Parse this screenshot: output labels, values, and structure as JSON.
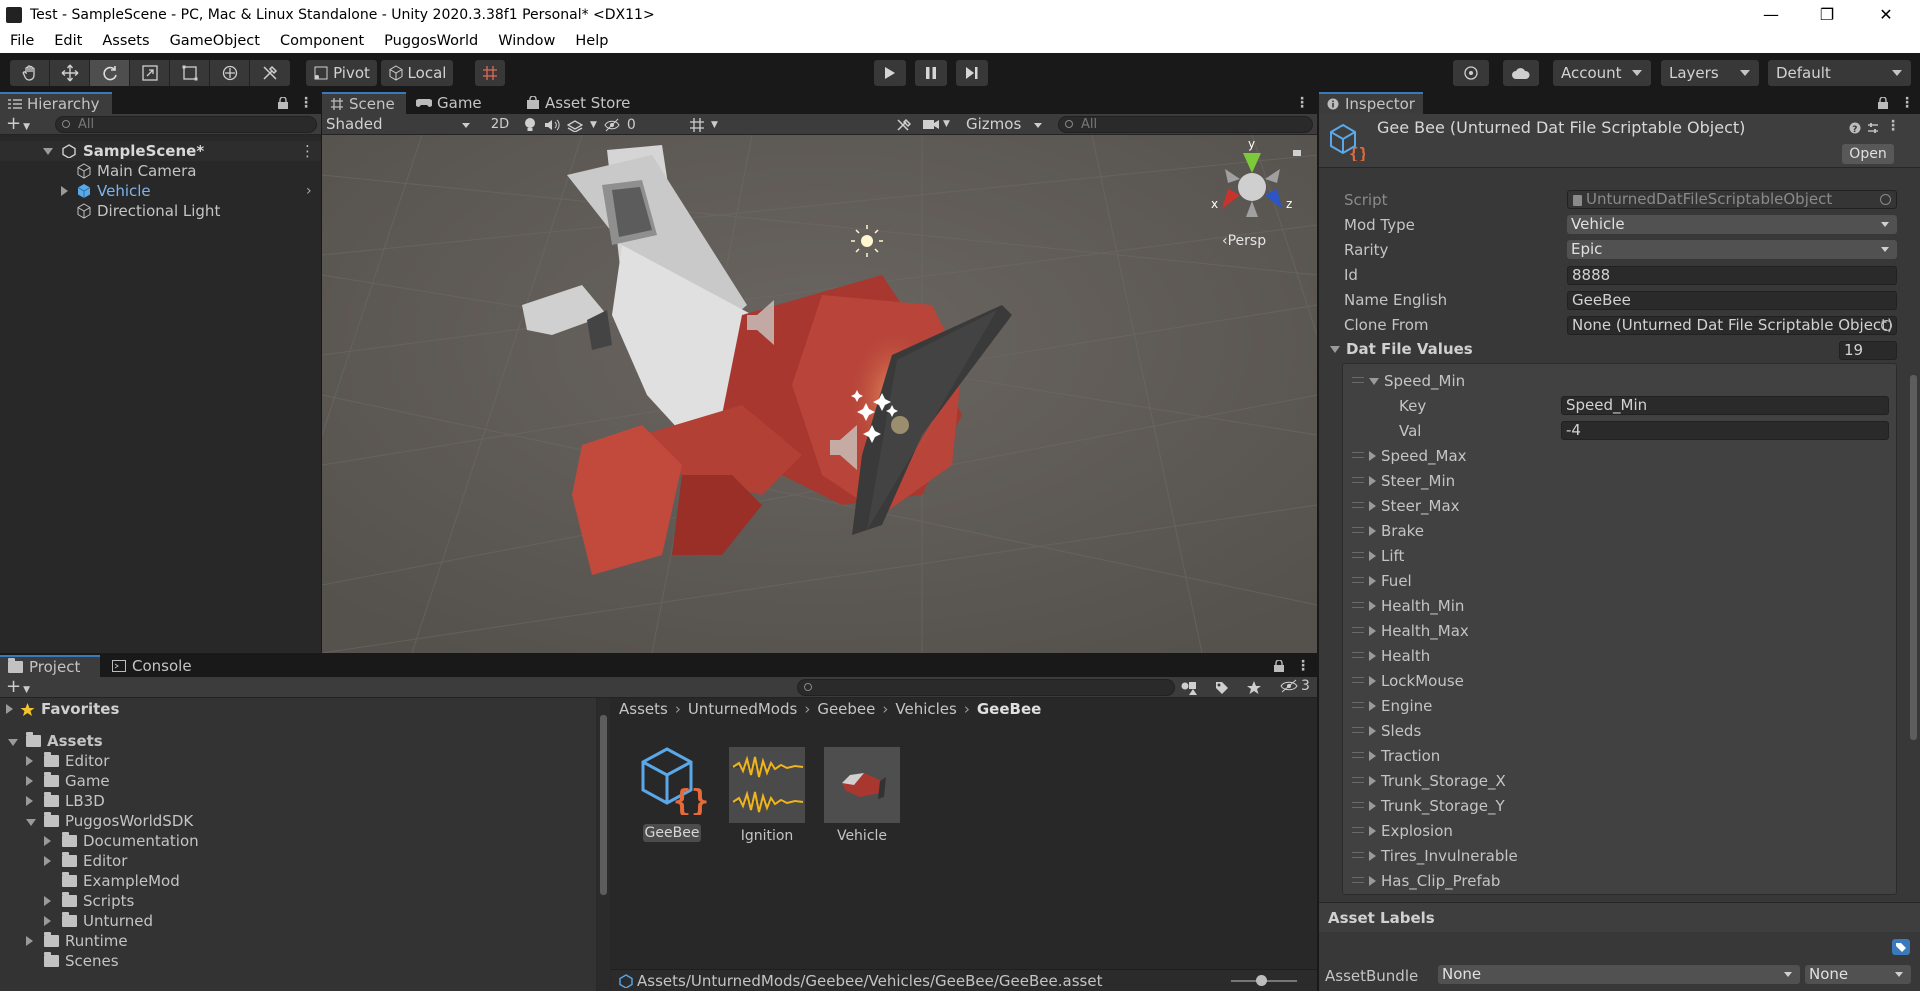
{
  "window": {
    "title": "Test - SampleScene - PC, Mac & Linux Standalone - Unity 2020.3.38f1 Personal* <DX11>"
  },
  "menu": [
    "File",
    "Edit",
    "Assets",
    "GameObject",
    "Component",
    "PuggosWorld",
    "Window",
    "Help"
  ],
  "toolbar": {
    "pivot": "Pivot",
    "local": "Local",
    "account": "Account",
    "layers": "Layers",
    "layout": "Default"
  },
  "hierarchy": {
    "tab": "Hierarchy",
    "search_placeholder": "All",
    "scene": "SampleScene*",
    "items": [
      "Main Camera",
      "Vehicle",
      "Directional Light"
    ]
  },
  "scene_view": {
    "tabs": [
      "Scene",
      "Game",
      "Asset Store"
    ],
    "shading": "Shaded",
    "mode_2d": "2D",
    "hidden_count": "0",
    "gizmos": "Gizmos",
    "search_placeholder": "All",
    "persp": "‹Persp",
    "axes": {
      "x": "x",
      "y": "y",
      "z": "z"
    }
  },
  "project": {
    "tabs": [
      "Project",
      "Console"
    ],
    "hidden_count": "3",
    "favorites": "Favorites",
    "tree": [
      {
        "label": "Assets",
        "depth": 0,
        "arrow": "open"
      },
      {
        "label": "Editor",
        "depth": 1,
        "arrow": "closed"
      },
      {
        "label": "Game",
        "depth": 1,
        "arrow": "closed"
      },
      {
        "label": "LB3D",
        "depth": 1,
        "arrow": "closed"
      },
      {
        "label": "PuggosWorldSDK",
        "depth": 1,
        "arrow": "open"
      },
      {
        "label": "Documentation",
        "depth": 2,
        "arrow": "closed"
      },
      {
        "label": "Editor",
        "depth": 2,
        "arrow": "closed"
      },
      {
        "label": "ExampleMod",
        "depth": 2,
        "arrow": "none"
      },
      {
        "label": "Scripts",
        "depth": 2,
        "arrow": "closed"
      },
      {
        "label": "Unturned",
        "depth": 2,
        "arrow": "closed"
      },
      {
        "label": "Runtime",
        "depth": 1,
        "arrow": "closed"
      },
      {
        "label": "Scenes",
        "depth": 1,
        "arrow": "none"
      }
    ],
    "breadcrumb": [
      "Assets",
      "UnturnedMods",
      "Geebee",
      "Vehicles",
      "GeeBee"
    ],
    "assets": [
      "GeeBee",
      "Ignition",
      "Vehicle"
    ],
    "status_path": "Assets/UnturnedMods/Geebee/Vehicles/GeeBee/GeeBee.asset",
    "zoom_level": 0.45
  },
  "inspector": {
    "tab": "Inspector",
    "object_title": "Gee Bee (Unturned Dat File Scriptable Object)",
    "open_button": "Open",
    "script_label": "Script",
    "script_value": "UnturnedDatFileScriptableObject",
    "mod_type_label": "Mod Type",
    "mod_type_value": "Vehicle",
    "rarity_label": "Rarity",
    "rarity_value": "Epic",
    "id_label": "Id",
    "id_value": "8888",
    "name_label": "Name English",
    "name_value": "GeeBee",
    "clone_label": "Clone From",
    "clone_value": "None (Unturned Dat File Scriptable Object)",
    "dat_label": "Dat File Values",
    "dat_count": "19",
    "first_element": "Speed_Min",
    "key_label": "Key",
    "key_value": "Speed_Min",
    "val_label": "Val",
    "val_value": "-4",
    "elements": [
      "Speed_Max",
      "Steer_Min",
      "Steer_Max",
      "Brake",
      "Lift",
      "Fuel",
      "Health_Min",
      "Health_Max",
      "Health",
      "LockMouse",
      "Engine",
      "Sleds",
      "Traction",
      "Trunk_Storage_X",
      "Trunk_Storage_Y",
      "Explosion",
      "Tires_Invulnerable",
      "Has_Clip_Prefab"
    ],
    "asset_labels": "Asset Labels",
    "assetbundle_label": "AssetBundle",
    "assetbundle_value": "None",
    "variant_value": "None"
  },
  "colors": {
    "accent": "#3a79bb",
    "plane_red": "#a8372f",
    "plane_white": "#d7d7d7",
    "scene_bg": "#5d5955"
  }
}
